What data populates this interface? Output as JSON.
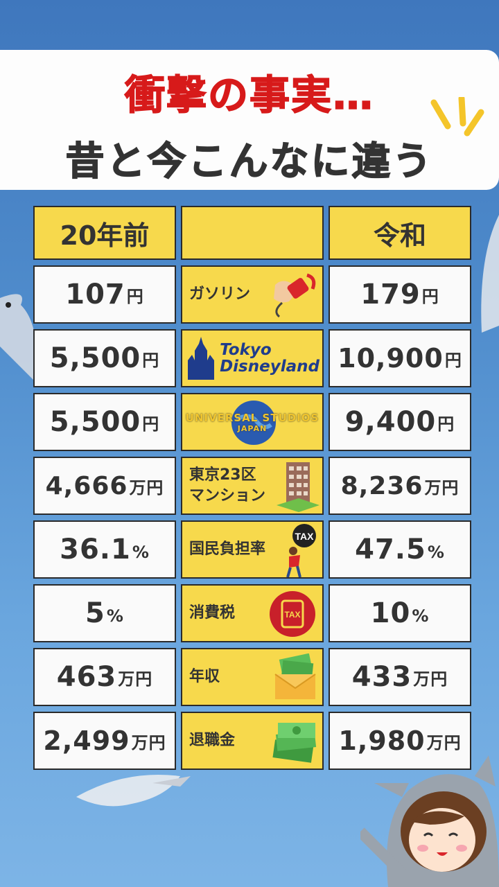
{
  "header": {
    "line1": "衝撃の事実…",
    "line2": "昔と今こんなに違う"
  },
  "table": {
    "col_left": "20年前",
    "col_mid": "",
    "col_right": "令和",
    "rows": [
      {
        "item": "ガソリン",
        "icon": "fuel-nozzle-icon",
        "old_num": "107",
        "old_unit": "円",
        "new_num": "179",
        "new_unit": "円"
      },
      {
        "item": "Tokyo Disneyland",
        "icon": "tokyo-disneyland-logo",
        "old_num": "5,500",
        "old_unit": "円",
        "new_num": "10,900",
        "new_unit": "円"
      },
      {
        "item": "UNIVERSAL STUDIOS JAPAN",
        "icon": "usj-globe-logo",
        "old_num": "5,500",
        "old_unit": "円",
        "new_num": "9,400",
        "new_unit": "円"
      },
      {
        "item": "東京23区マンション",
        "item_l1": "東京23区",
        "item_l2": "マンション",
        "icon": "apartment-building-icon",
        "old_num": "4,666",
        "old_unit": "万円",
        "new_num": "8,236",
        "new_unit": "万円"
      },
      {
        "item": "国民負担率",
        "icon": "tax-burden-icon",
        "old_num": "36.1",
        "old_unit": "%",
        "new_num": "47.5",
        "new_unit": "%"
      },
      {
        "item": "消費税",
        "icon": "tax-stamp-icon",
        "old_num": "5",
        "old_unit": "%",
        "new_num": "10",
        "new_unit": "%"
      },
      {
        "item": "年収",
        "icon": "money-envelope-icon",
        "old_num": "463",
        "old_unit": "万円",
        "new_num": "433",
        "new_unit": "万円"
      },
      {
        "item": "退職金",
        "icon": "cash-stack-icon",
        "old_num": "2,499",
        "old_unit": "万円",
        "new_num": "1,980",
        "new_unit": "万円"
      }
    ]
  },
  "logos": {
    "tdl_line1": "Tokyo",
    "tdl_line2": "Disneyland",
    "usj_line1": "UNIVERSAL STUDIOS",
    "usj_line2": "JAPAN",
    "tax_badge": "TAX",
    "tax_stamp": "TAX"
  },
  "colors": {
    "accent_yellow": "#f7d94c",
    "title_red": "#d71a1a",
    "sky_blue": "#4f8ccc"
  }
}
